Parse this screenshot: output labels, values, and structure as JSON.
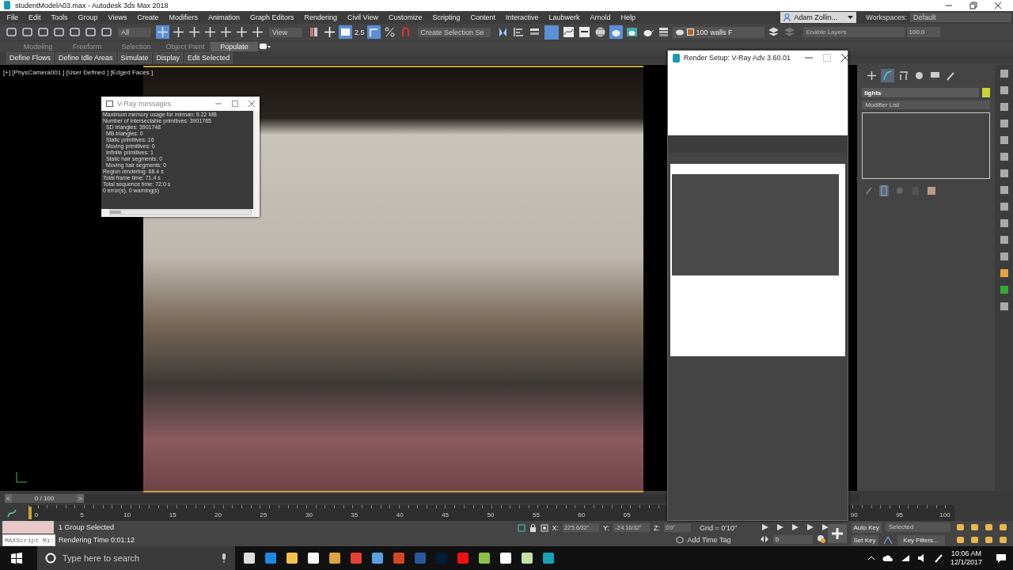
{
  "window": {
    "title": "studentModelA03.max - Autodesk 3ds Max 2018"
  },
  "menu": [
    "File",
    "Edit",
    "Tools",
    "Group",
    "Views",
    "Create",
    "Modifiers",
    "Animation",
    "Graph Editors",
    "Rendering",
    "Civil View",
    "Customize",
    "Scripting",
    "Content",
    "Interactive",
    "Laubwerk",
    "Arnold",
    "Help"
  ],
  "user": {
    "name": "Adam Zollin...",
    "workspaces_label": "Workspaces:",
    "workspace": "Default"
  },
  "toolbar": {
    "selection_filter": "All",
    "reference_coord": "View",
    "snap_value": "2.5",
    "named_selection": "Create Selection Se",
    "layer_count": "100",
    "layer_name": "walls F",
    "layer_placeholder": "Enable Layers",
    "layer_value": "100.0"
  },
  "ribbon": {
    "tabs": [
      {
        "label": "Modeling",
        "selected": false
      },
      {
        "label": "Freeform",
        "selected": false
      },
      {
        "label": "Selection",
        "selected": false
      },
      {
        "label": "Object Paint",
        "selected": false
      },
      {
        "label": "Populate",
        "selected": true
      }
    ],
    "commands": [
      "Define Flows",
      "Define Idle Areas",
      "Simulate",
      "Display",
      "Edit Selected"
    ]
  },
  "viewport": {
    "label": "[+] [PhysCamera001 ] [User Defined ] [Edged Faces ]"
  },
  "vray_messages": {
    "title": "V-Ray messages",
    "lines": [
      "Maximum memory usage for mirman: 9.22 MB",
      "Number of intersectable primitives: 3901765",
      "  SD triangles: 3901748",
      "  MB triangles: 0",
      "  Static primitives: 16",
      "  Moving primitives: 0",
      "  Infinite primitives: 1",
      "  Static hair segments: 0",
      "  Moving hair segments: 0",
      "Region rendering: 68.4 s",
      "Total frame time: 71.4 s",
      "Total sequence time: 72.0 s",
      "0 error(s), 0 warning(s)"
    ]
  },
  "render_setup": {
    "title": "Render Setup: V-Ray Adv 3.60.01"
  },
  "command_panel": {
    "tabs": [
      {
        "kind": "create",
        "selected": false
      },
      {
        "kind": "modify",
        "selected": true
      },
      {
        "kind": "hierarchy",
        "selected": false
      },
      {
        "kind": "motion",
        "selected": false
      },
      {
        "kind": "display",
        "selected": false
      },
      {
        "kind": "utilities",
        "selected": false
      }
    ],
    "object_name": "lights",
    "modifier_list": "Modifier List"
  },
  "time_slider": {
    "prev": "<",
    "position": "0 / 100",
    "next": ">",
    "level": 0
  },
  "track_ticks": [
    "0",
    "5",
    "10",
    "15",
    "20",
    "25",
    "30",
    "35",
    "40",
    "45",
    "50",
    "55",
    "60",
    "65",
    "90",
    "95",
    "100"
  ],
  "status": {
    "listener_placeholder": "MAXScript Mi:",
    "selection": "1 Group Selected",
    "prompt": "Rendering Time  0:01:12",
    "x_label": "X:",
    "x": "22'5 6/32\"",
    "y_label": "Y:",
    "y": "-2'4 16/32\"",
    "z_label": "Z:",
    "z": "0'0\"",
    "grid": "Grid = 0'10\"",
    "time_tag": "Add Time Tag",
    "frame": "0",
    "auto_key": "Auto Key",
    "key_mode": "Selected",
    "set_key": "Set Key",
    "key_filters": "Key Filters..."
  },
  "taskbar": {
    "search_placeholder": "Type here to search",
    "time": "10:06 AM",
    "date": "12/1/2017"
  }
}
